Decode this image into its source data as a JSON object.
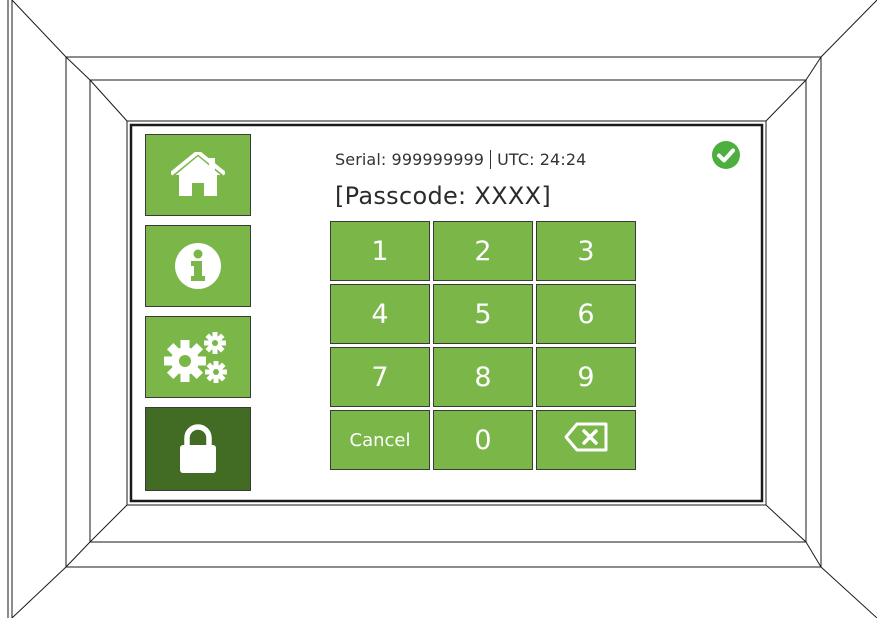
{
  "sidebar": {
    "items": [
      {
        "id": "home",
        "icon": "home-icon"
      },
      {
        "id": "info",
        "icon": "info-icon"
      },
      {
        "id": "settings",
        "icon": "gears-icon"
      },
      {
        "id": "lock",
        "icon": "lock-icon",
        "active": true
      }
    ]
  },
  "header": {
    "serial": "Serial: 999999999",
    "utc": "UTC: 24:24",
    "status_icon": "check-circle-icon"
  },
  "passcode": {
    "display": "[Passcode: XXXX]"
  },
  "keypad": {
    "k1": "1",
    "k2": "2",
    "k3": "3",
    "k4": "4",
    "k5": "5",
    "k6": "6",
    "k7": "7",
    "k8": "8",
    "k9": "9",
    "cancel": "Cancel",
    "k0": "0",
    "backspace_icon": "backspace-icon"
  },
  "colors": {
    "button_green": "#7ab648",
    "active_green": "#426b24",
    "status_green": "#4caf3e"
  }
}
